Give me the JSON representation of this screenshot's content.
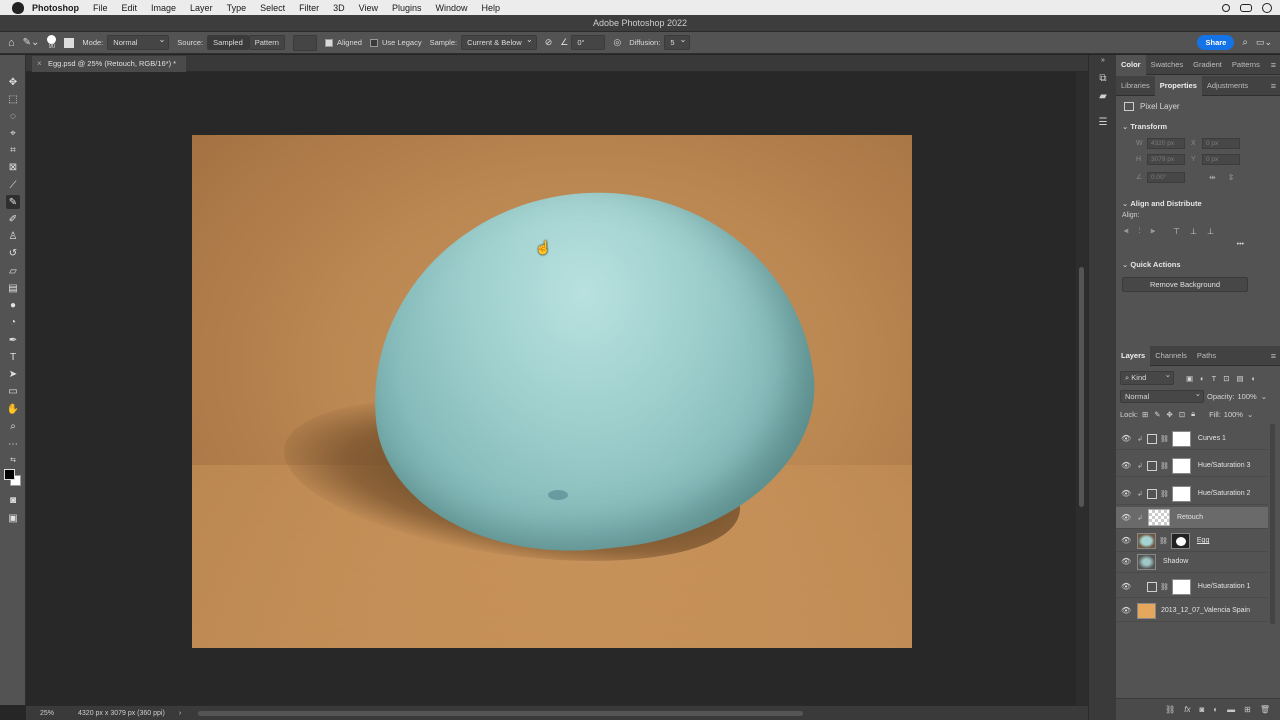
{
  "menubar": {
    "app_name": "Photoshop",
    "items": [
      "File",
      "Edit",
      "Image",
      "Layer",
      "Type",
      "Select",
      "Filter",
      "3D",
      "View",
      "Plugins",
      "Window",
      "Help"
    ]
  },
  "window": {
    "title": "Adobe Photoshop 2022"
  },
  "options": {
    "brush_size": "90",
    "mode_label": "Mode:",
    "mode_value": "Normal",
    "source_label": "Source:",
    "source_sampled": "Sampled",
    "source_pattern": "Pattern",
    "aligned_label": "Aligned",
    "use_legacy_label": "Use Legacy",
    "sample_label": "Sample:",
    "sample_value": "Current & Below",
    "angle_value": "0°",
    "diffusion_label": "Diffusion:",
    "diffusion_value": "5",
    "share_label": "Share"
  },
  "document": {
    "tab_title": "Egg.psd @ 25% (Retouch, RGB/16*) *",
    "close_glyph": "×"
  },
  "status": {
    "zoom": "25%",
    "dimensions": "4320 px x 3079 px (360 ppi)",
    "arrow": "›"
  },
  "panels": {
    "top_tabs": [
      "Color",
      "Swatches",
      "Gradient",
      "Patterns"
    ],
    "mid_tabs": [
      "Libraries",
      "Properties",
      "Adjustments"
    ],
    "properties": {
      "layer_type": "Pixel Layer",
      "transform_heading": "Transform",
      "w_label": "W",
      "w_value": "4320 px",
      "h_label": "H",
      "h_value": "3079 px",
      "x_label": "X",
      "x_value": "0 px",
      "y_label": "Y",
      "y_value": "0 px",
      "angle_value": "0.00°",
      "align_heading": "Align and Distribute",
      "align_label": "Align:",
      "more_glyph": "•••",
      "quick_actions_heading": "Quick Actions",
      "remove_bg_label": "Remove Background"
    },
    "layer_tabs": [
      "Layers",
      "Channels",
      "Paths"
    ],
    "layers_controls": {
      "kind": "Kind",
      "blend_mode": "Normal",
      "opacity_label": "Opacity:",
      "opacity_value": "100%",
      "lock_label": "Lock:",
      "fill_label": "Fill:",
      "fill_value": "100%"
    },
    "layers": [
      {
        "name": "Curves 1"
      },
      {
        "name": "Hue/Saturation 3"
      },
      {
        "name": "Hue/Saturation 2"
      },
      {
        "name": "Retouch"
      },
      {
        "name": "Egg"
      },
      {
        "name": "Shadow"
      },
      {
        "name": "Hue/Saturation 1"
      },
      {
        "name": "2013_12_07_Valencia Spain"
      }
    ]
  },
  "colors": {
    "accent": "#1473e6",
    "panel_bg": "#535353",
    "canvas_bg": "#282828",
    "egg": "#9fd0ce",
    "background_photo": "#bb8752"
  }
}
